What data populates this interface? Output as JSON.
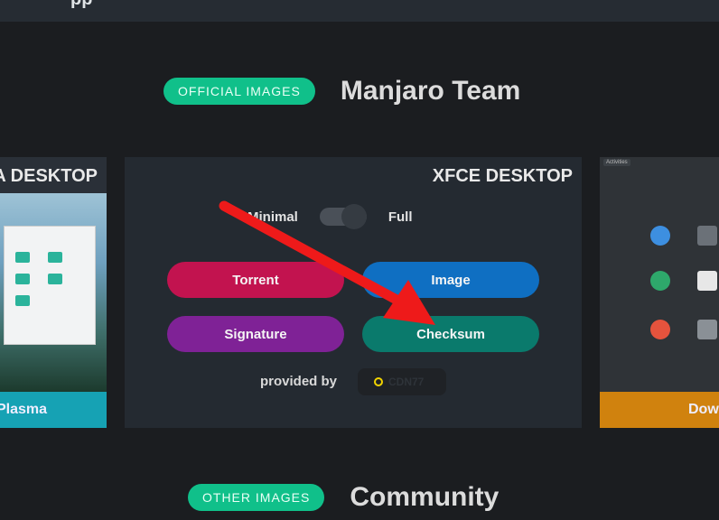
{
  "topbar": {
    "title_fragment": "pp"
  },
  "official": {
    "pill": "OFFICIAL IMAGES",
    "title": "Manjaro Team"
  },
  "other": {
    "pill": "OTHER IMAGES",
    "title": "Community"
  },
  "cards": {
    "left": {
      "title": "A DESKTOP",
      "footer": "Plasma"
    },
    "center": {
      "title": "XFCE DESKTOP",
      "toggle": {
        "left_label": "Minimal",
        "right_label": "Full",
        "selected": "Full"
      },
      "buttons": {
        "torrent": "Torrent",
        "image": "Image",
        "signature": "Signature",
        "checksum": "Checksum"
      },
      "provided_by": "provided by",
      "cdn": "CDN77"
    },
    "right": {
      "footer": "Dow",
      "tab": "Activities"
    }
  },
  "colors": {
    "accent_green": "#10c08a",
    "torrent": "#c2134f",
    "image": "#0f6fc2",
    "signature": "#7f2296",
    "checksum": "#0a7a6c",
    "plasma_footer": "#16a2b4",
    "right_footer": "#d0820e",
    "arrow": "#ee1a1a"
  }
}
